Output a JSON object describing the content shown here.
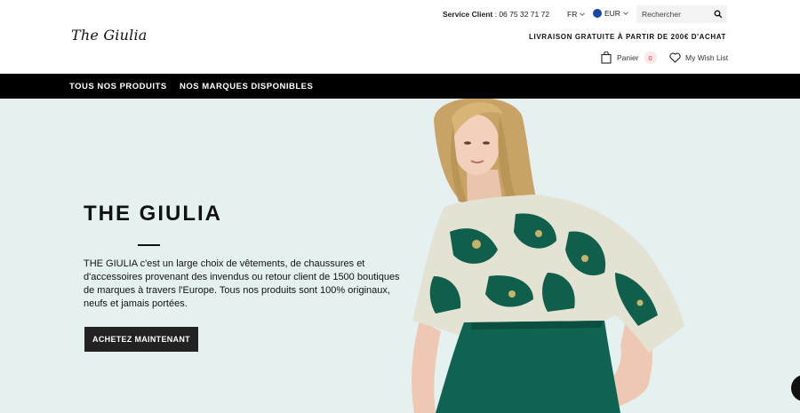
{
  "header": {
    "logo": "The Giulia",
    "service_label": "Service Client",
    "service_phone": ": 06 75 32 71 72",
    "language": "FR",
    "currency": "EUR",
    "search_placeholder": "Rechercher",
    "shipping_notice": "LIVRAISON GRATUITE À PARTIR DE 200€ D'ACHAT",
    "cart_label": "Panier",
    "cart_count": "0",
    "wishlist_label": "My Wish List"
  },
  "nav": {
    "items": [
      {
        "label": "TOUS NOS PRODUITS"
      },
      {
        "label": "NOS MARQUES DISPONIBLES"
      }
    ]
  },
  "hero": {
    "title": "THE GIULIA",
    "text": "THE GIULIA c'est un large choix de vêtements, de chaussures et d'accessoires provenant des invendus ou retour client de 1500 boutiques de marques à travers l'Europe. Tous nos produits sont 100% originaux, neufs et jamais portées.",
    "cta_label": "ACHETEZ MAINTENANT"
  },
  "colors": {
    "nav_bg": "#000000",
    "hero_bg": "#e5f1f1",
    "cta_bg": "#222222",
    "dress_green": "#0f5f4c",
    "cart_badge": "#fde7e7"
  }
}
